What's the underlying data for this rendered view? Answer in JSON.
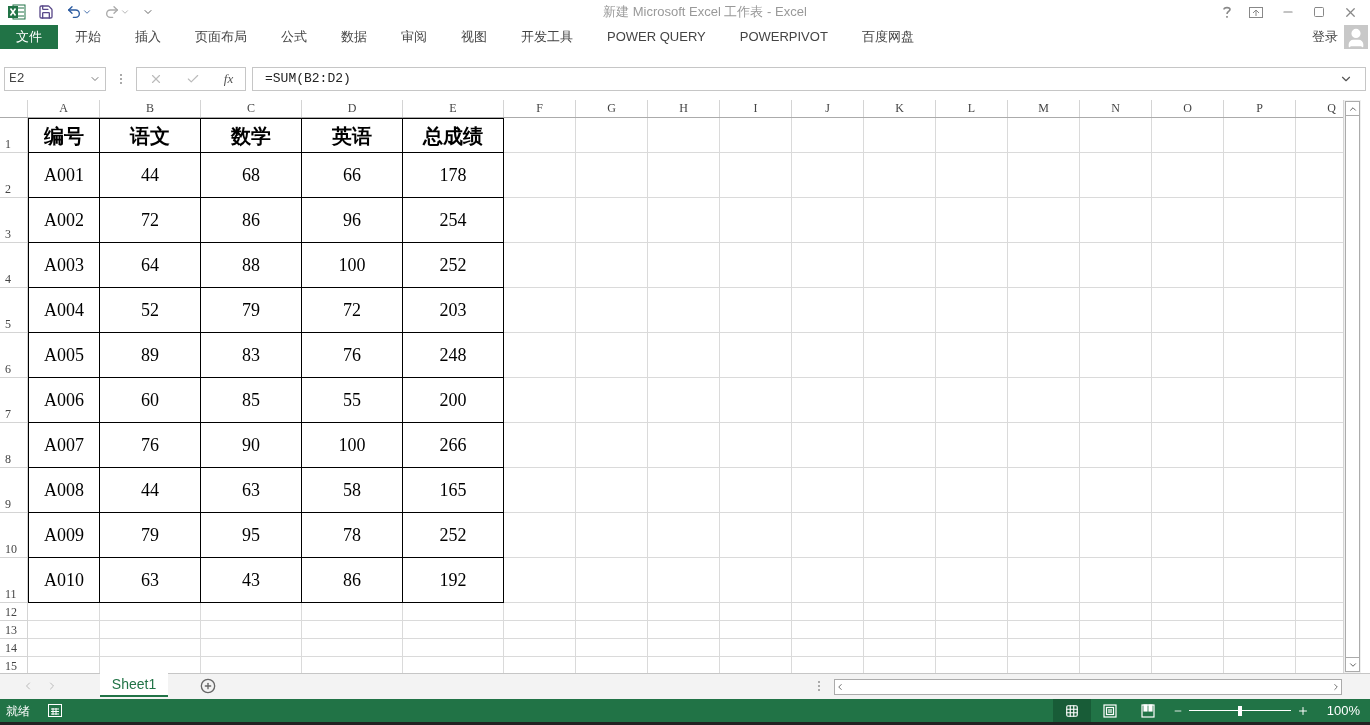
{
  "window": {
    "title": "新建 Microsoft Excel 工作表 - Excel"
  },
  "ribbon_tabs": [
    {
      "label": "文件",
      "kind": "file"
    },
    {
      "label": "开始",
      "kind": "tab"
    },
    {
      "label": "插入",
      "kind": "tab"
    },
    {
      "label": "页面布局",
      "kind": "tab"
    },
    {
      "label": "公式",
      "kind": "tab"
    },
    {
      "label": "数据",
      "kind": "tab"
    },
    {
      "label": "审阅",
      "kind": "tab"
    },
    {
      "label": "视图",
      "kind": "tab"
    },
    {
      "label": "开发工具",
      "kind": "tab"
    },
    {
      "label": "POWER QUERY",
      "kind": "tab"
    },
    {
      "label": "POWERPIVOT",
      "kind": "tab"
    },
    {
      "label": "百度网盘",
      "kind": "tab"
    }
  ],
  "account": {
    "label": "登录"
  },
  "formula_bar": {
    "name_box": "E2",
    "function_label": "fx",
    "formula": "=SUM(B2:D2)"
  },
  "columns": [
    "A",
    "B",
    "C",
    "D",
    "E",
    "F",
    "G",
    "H",
    "I",
    "J",
    "K",
    "L",
    "M",
    "N",
    "O",
    "P",
    "Q"
  ],
  "rows": [
    {
      "header": "1",
      "kind": "header",
      "cells": [
        "编号",
        "语文",
        "数学",
        "英语",
        "总成绩"
      ]
    },
    {
      "header": "2",
      "kind": "data",
      "cells": [
        "A001",
        "44",
        "68",
        "66",
        "178"
      ]
    },
    {
      "header": "3",
      "kind": "data",
      "cells": [
        "A002",
        "72",
        "86",
        "96",
        "254"
      ]
    },
    {
      "header": "4",
      "kind": "data",
      "cells": [
        "A003",
        "64",
        "88",
        "100",
        "252"
      ]
    },
    {
      "header": "5",
      "kind": "data",
      "cells": [
        "A004",
        "52",
        "79",
        "72",
        "203"
      ]
    },
    {
      "header": "6",
      "kind": "data",
      "cells": [
        "A005",
        "89",
        "83",
        "76",
        "248"
      ]
    },
    {
      "header": "7",
      "kind": "data",
      "cells": [
        "A006",
        "60",
        "85",
        "55",
        "200"
      ]
    },
    {
      "header": "8",
      "kind": "data",
      "cells": [
        "A007",
        "76",
        "90",
        "100",
        "266"
      ]
    },
    {
      "header": "9",
      "kind": "data",
      "cells": [
        "A008",
        "44",
        "63",
        "58",
        "165"
      ]
    },
    {
      "header": "10",
      "kind": "data",
      "cells": [
        "A009",
        "79",
        "95",
        "78",
        "252"
      ]
    },
    {
      "header": "11",
      "kind": "data",
      "cells": [
        "A010",
        "63",
        "43",
        "86",
        "192"
      ]
    },
    {
      "header": "12",
      "kind": "empty",
      "cells": []
    },
    {
      "header": "13",
      "kind": "empty",
      "cells": []
    },
    {
      "header": "14",
      "kind": "empty",
      "cells": []
    },
    {
      "header": "15",
      "kind": "empty",
      "cells": []
    }
  ],
  "sheet_tabs": [
    {
      "label": "Sheet1",
      "selected": true
    }
  ],
  "status_bar": {
    "text": "就绪",
    "views": [
      {
        "kind": "normal",
        "selected": true
      },
      {
        "kind": "page_layout",
        "selected": false
      },
      {
        "kind": "page_break",
        "selected": false
      }
    ],
    "zoom": {
      "level": 0.5,
      "reading": "100%"
    }
  }
}
